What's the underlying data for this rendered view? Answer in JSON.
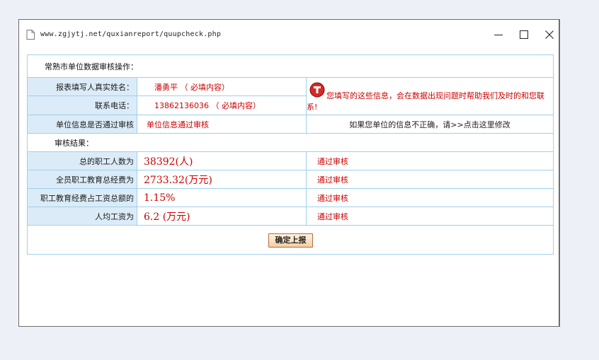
{
  "window": {
    "url": "www.zgjytj.net/quxianreport/quupcheck.php",
    "icons": [
      "page-icon",
      "minimize-icon",
      "maximize-icon",
      "close-icon"
    ]
  },
  "form": {
    "section_title": "常熟市单位数据审核操作：",
    "name_label": "报表填写人真实姓名：",
    "name_value": "潘勇平 （ 必填内容）",
    "phone_label": "联系电话：",
    "phone_value": "13862136036 （ 必填内容）",
    "hint_text": "您填写的这些信息，会在数据出现问题时帮助我们及时的和您联系!",
    "approval_label": "单位信息是否通过审核",
    "approval_value": "单位信息通过审核",
    "modify_link": "如果您单位的信息不正确，请>>点击这里修改"
  },
  "results": {
    "title": "审核结果：",
    "rows": [
      {
        "label": "总的职工人数为",
        "value": "38392(人)",
        "status": "通过审核"
      },
      {
        "label": "全员职工教育总经费为",
        "value": "2733.32(万元)",
        "status": "通过审核"
      },
      {
        "label": "职工教育经费占工资总额的",
        "value": "1.15%",
        "status": "通过审核"
      },
      {
        "label": "人均工资为",
        "value": "6.2 (万元)",
        "status": "通过审核"
      }
    ]
  },
  "submit_label": "确定上报",
  "colors": {
    "label_bg": "#dbecf8",
    "border": "#9fd0ea",
    "accent_red": "#cc0000",
    "button_bg": "#f2cfa6"
  }
}
